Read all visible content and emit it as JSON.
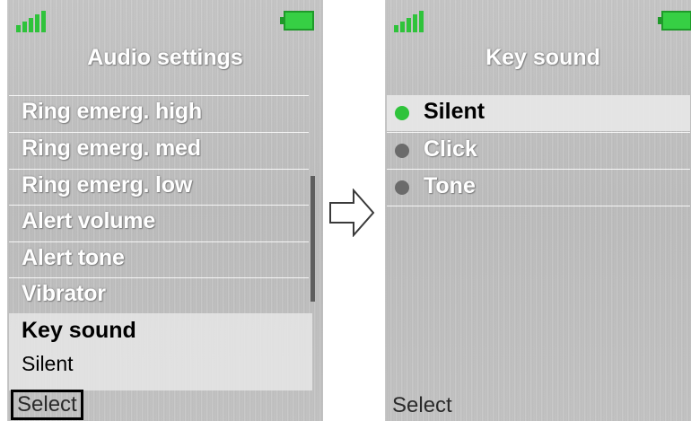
{
  "left_screen": {
    "title": "Audio settings",
    "items": [
      {
        "label": "Ring emerg. high"
      },
      {
        "label": "Ring emerg. med"
      },
      {
        "label": "Ring emerg. low"
      },
      {
        "label": "Alert volume"
      },
      {
        "label": "Alert tone"
      },
      {
        "label": "Vibrator"
      }
    ],
    "selected": {
      "label": "Key sound",
      "value": "Silent"
    },
    "softkey": "Select"
  },
  "right_screen": {
    "title": "Key sound",
    "options": [
      {
        "label": "Silent",
        "selected": true
      },
      {
        "label": "Click",
        "selected": false
      },
      {
        "label": "Tone",
        "selected": false
      }
    ],
    "softkey": "Select"
  },
  "colors": {
    "signal": "#2fc33b",
    "battery": "#36cf44",
    "radio_selected": "#2fc33b",
    "radio_unselected": "#6b6b6b"
  },
  "icons": {
    "signal": "signal-strength-icon",
    "battery": "battery-icon",
    "transition": "right-arrow-icon"
  }
}
